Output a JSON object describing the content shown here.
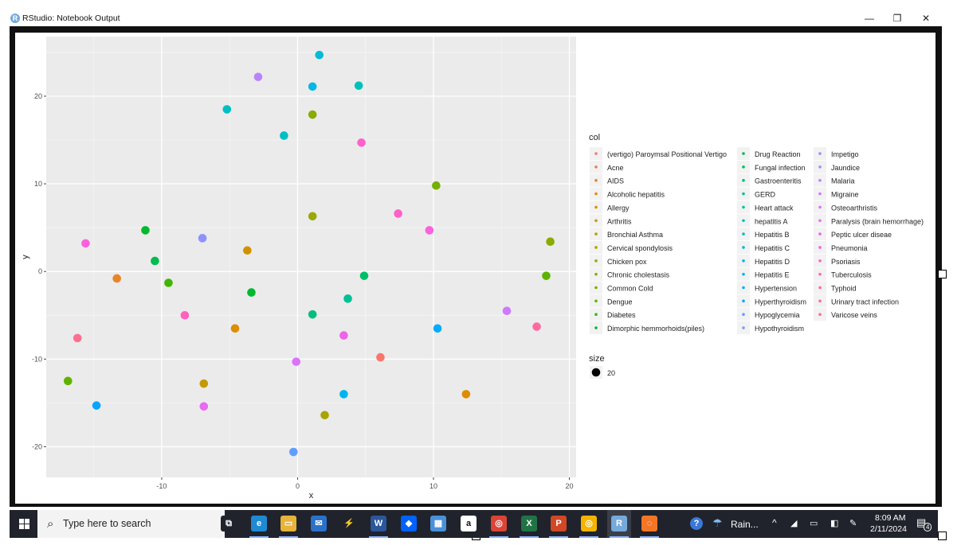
{
  "window": {
    "title": "RStudio: Notebook Output",
    "app_icon": "R",
    "minimize_icon": "—",
    "restore_icon": "❐",
    "close_icon": "✕"
  },
  "chart_data": {
    "type": "scatter",
    "xlabel": "x",
    "ylabel": "y",
    "xlim": [
      -18.5,
      20.5
    ],
    "ylim": [
      -23.5,
      26.8
    ],
    "x_ticks": [
      -10,
      0,
      10,
      20
    ],
    "y_ticks": [
      -20,
      -10,
      0,
      10,
      20
    ],
    "grid": true,
    "legend_placement": "right",
    "legend_title": "col",
    "size_legend_title": "size",
    "size_legend_value": "20",
    "categories": [
      "(vertigo) Paroymsal  Positional Vertigo",
      "Acne",
      "AIDS",
      "Alcoholic hepatitis",
      "Allergy",
      "Arthritis",
      "Bronchial Asthma",
      "Cervical spondylosis",
      "Chicken pox",
      "Chronic cholestasis",
      "Common Cold",
      "Dengue",
      "Diabetes",
      "Dimorphic hemmorhoids(piles)",
      "Drug Reaction",
      "Fungal infection",
      "Gastroenteritis",
      "GERD",
      "Heart attack",
      "hepatitis A",
      "Hepatitis B",
      "Hepatitis C",
      "Hepatitis D",
      "Hepatitis E",
      "Hypertension",
      "Hyperthyroidism",
      "Hypoglycemia",
      "Hypothyroidism",
      "Impetigo",
      "Jaundice",
      "Malaria",
      "Migraine",
      "Osteoarthristis",
      "Paralysis (brain hemorrhage)",
      "Peptic ulcer diseae",
      "Pneumonia",
      "Psoriasis",
      "Tuberculosis",
      "Typhoid",
      "Urinary tract infection",
      "Varicose veins"
    ],
    "colors": [
      "#F8766D",
      "#F17E4A",
      "#E88526",
      "#DE8C00",
      "#D29200",
      "#C49A00",
      "#B79F00",
      "#A9A400",
      "#9AA800",
      "#8AAB00",
      "#75AF00",
      "#5EB300",
      "#3FB600",
      "#00B92E",
      "#00BB4E",
      "#00BE67",
      "#00BF7D",
      "#00C094",
      "#00C0A8",
      "#00C0B8",
      "#00BFC4",
      "#00BCD8",
      "#00B8E7",
      "#00B4F0",
      "#00ACFC",
      "#0AA4FF",
      "#619CFF",
      "#7F96FF",
      "#8F91FF",
      "#A58AFF",
      "#B983FF",
      "#CE79FF",
      "#DB72FB",
      "#E76BF3",
      "#F063E8",
      "#F962DD",
      "#FF61C9",
      "#FF62BC",
      "#FF65AE",
      "#FF69A0",
      "#FC6F91"
    ],
    "points": [
      {
        "x": -7.0,
        "y": 3.8,
        "c": 28
      },
      {
        "x": 1.6,
        "y": 24.7,
        "c": 21
      },
      {
        "x": -2.9,
        "y": 22.2,
        "c": 30
      },
      {
        "x": 1.1,
        "y": 21.1,
        "c": 22
      },
      {
        "x": 4.5,
        "y": 21.2,
        "c": 19
      },
      {
        "x": -5.2,
        "y": 18.5,
        "c": 20
      },
      {
        "x": 1.1,
        "y": 17.9,
        "c": 9
      },
      {
        "x": -1.0,
        "y": 15.5,
        "c": 20
      },
      {
        "x": 4.7,
        "y": 14.7,
        "c": 36
      },
      {
        "x": 10.2,
        "y": 9.8,
        "c": 10
      },
      {
        "x": 1.1,
        "y": 6.3,
        "c": 8
      },
      {
        "x": 7.4,
        "y": 6.6,
        "c": 36
      },
      {
        "x": -11.2,
        "y": 4.7,
        "c": 13
      },
      {
        "x": 9.7,
        "y": 4.7,
        "c": 35
      },
      {
        "x": 18.6,
        "y": 3.4,
        "c": 9
      },
      {
        "x": -15.6,
        "y": 3.2,
        "c": 35
      },
      {
        "x": -3.7,
        "y": 2.4,
        "c": 4
      },
      {
        "x": -10.5,
        "y": 1.2,
        "c": 14
      },
      {
        "x": -13.3,
        "y": -0.8,
        "c": 2
      },
      {
        "x": 4.9,
        "y": -0.5,
        "c": 15
      },
      {
        "x": 18.3,
        "y": -0.5,
        "c": 11
      },
      {
        "x": -9.5,
        "y": -1.3,
        "c": 12
      },
      {
        "x": -3.4,
        "y": -2.4,
        "c": 13
      },
      {
        "x": 3.7,
        "y": -3.1,
        "c": 17
      },
      {
        "x": 15.4,
        "y": -4.5,
        "c": 31
      },
      {
        "x": 1.1,
        "y": -4.9,
        "c": 16
      },
      {
        "x": -8.3,
        "y": -5.0,
        "c": 37
      },
      {
        "x": -4.6,
        "y": -6.5,
        "c": 3
      },
      {
        "x": 10.3,
        "y": -6.5,
        "c": 24
      },
      {
        "x": 17.6,
        "y": -6.3,
        "c": 39
      },
      {
        "x": 3.4,
        "y": -7.3,
        "c": 34
      },
      {
        "x": -16.2,
        "y": -7.6,
        "c": 40
      },
      {
        "x": 6.1,
        "y": -9.8,
        "c": 0
      },
      {
        "x": -0.1,
        "y": -10.3,
        "c": 32
      },
      {
        "x": -16.9,
        "y": -12.5,
        "c": 11
      },
      {
        "x": -6.9,
        "y": -12.8,
        "c": 5
      },
      {
        "x": 3.4,
        "y": -14.0,
        "c": 23
      },
      {
        "x": 12.4,
        "y": -14.0,
        "c": 3
      },
      {
        "x": -14.8,
        "y": -15.3,
        "c": 25
      },
      {
        "x": -6.9,
        "y": -15.4,
        "c": 33
      },
      {
        "x": 2.0,
        "y": -16.4,
        "c": 7
      },
      {
        "x": -0.3,
        "y": -20.6,
        "c": 26
      }
    ]
  },
  "taskbar": {
    "search_placeholder": "Type here to search",
    "weather_text": "Rain...",
    "time": "8:09 AM",
    "date": "2/11/2024",
    "notification_count": "4",
    "apps": [
      {
        "name": "task-view-icon",
        "glyph": "⧉",
        "color": "#20232b"
      },
      {
        "name": "edge-icon",
        "glyph": "e",
        "color": "#1f8ad2"
      },
      {
        "name": "file-explorer-icon",
        "glyph": "▭",
        "color": "#e8b339"
      },
      {
        "name": "mail-icon",
        "glyph": "✉",
        "color": "#2a72c9"
      },
      {
        "name": "terminal-icon",
        "glyph": "⚡",
        "color": "#20232b"
      },
      {
        "name": "word-icon",
        "glyph": "W",
        "color": "#2b579a"
      },
      {
        "name": "dropbox-icon",
        "glyph": "◆",
        "color": "#0061fe"
      },
      {
        "name": "store-icon",
        "glyph": "▦",
        "color": "#4a90d9"
      },
      {
        "name": "amazon-icon",
        "glyph": "a",
        "color": "#ffffff"
      },
      {
        "name": "chrome-icon",
        "glyph": "◎",
        "color": "#db4437"
      },
      {
        "name": "excel-icon",
        "glyph": "X",
        "color": "#217346"
      },
      {
        "name": "powerpoint-icon",
        "glyph": "P",
        "color": "#d24726"
      },
      {
        "name": "chrome-alt-icon",
        "glyph": "◎",
        "color": "#f4b400"
      },
      {
        "name": "rstudio-icon",
        "glyph": "R",
        "color": "#75aadb"
      },
      {
        "name": "jupyter-icon",
        "glyph": "◌",
        "color": "#f37626"
      }
    ]
  }
}
